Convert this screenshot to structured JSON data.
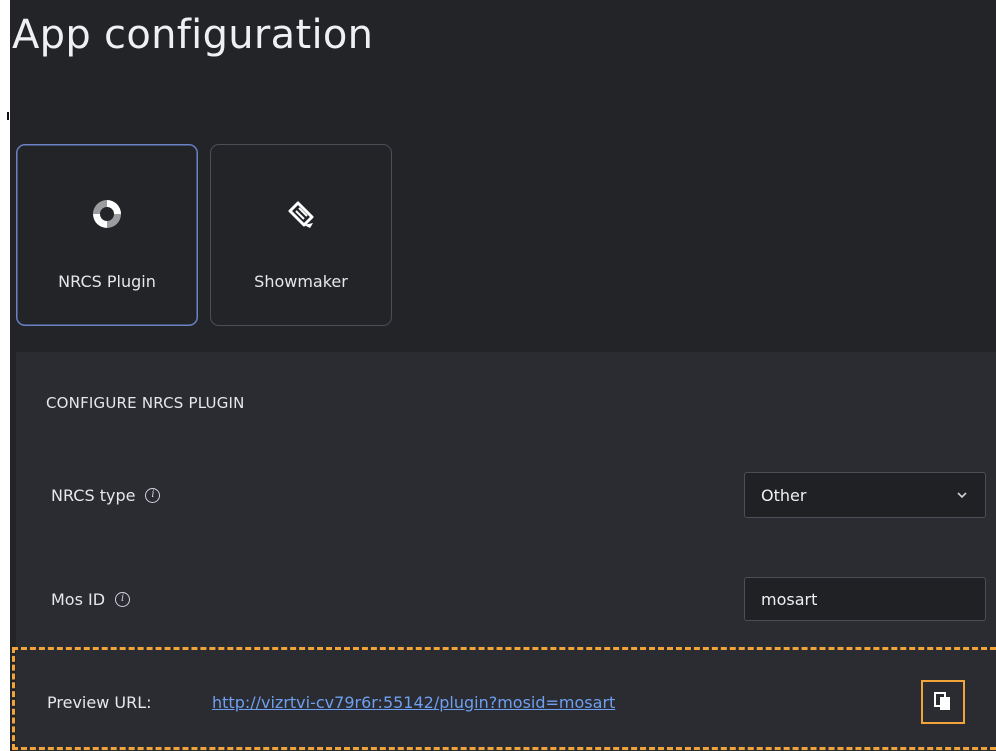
{
  "page": {
    "title": "App configuration"
  },
  "tiles": [
    {
      "label": "NRCS Plugin",
      "icon": "nrcs-plugin-icon",
      "active": true
    },
    {
      "label": "Showmaker",
      "icon": "showmaker-icon",
      "active": false
    }
  ],
  "section": {
    "title": "CONFIGURE NRCS PLUGIN"
  },
  "fields": {
    "nrcs_type": {
      "label": "NRCS type",
      "value": "Other",
      "info_icon": "info-icon"
    },
    "mos_id": {
      "label": "Mos ID",
      "value": "mosart",
      "info_icon": "info-icon"
    }
  },
  "preview": {
    "label": "Preview URL:",
    "url": "http://vizrtvi-cv79r6r:55142/plugin?mosid=mosart",
    "copy_icon": "copy-icon"
  },
  "colors": {
    "background": "#222428",
    "panel": "#2a2c31",
    "active_border": "#6c83c9",
    "link": "#6f9ff0",
    "highlight": "#f0a43a"
  }
}
